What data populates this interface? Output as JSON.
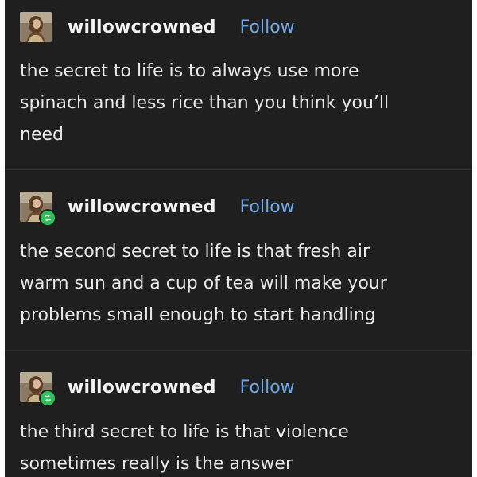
{
  "posts": [
    {
      "username": "willowcrowned",
      "follow_label": "Follow",
      "reblog": false,
      "text": "the secret to life is to always use more\nspinach and less rice than you think you’ll\nneed"
    },
    {
      "username": "willowcrowned",
      "follow_label": "Follow",
      "reblog": true,
      "text": "the second secret to life is that fresh air\nwarm sun and a cup of tea will make your\nproblems small enough to start handling"
    },
    {
      "username": "willowcrowned",
      "follow_label": "Follow",
      "reblog": true,
      "text": "the third secret to life is that violence\nsometimes really is the answer"
    }
  ],
  "colors": {
    "background": "#1f1f1f",
    "text": "#e8e8e8",
    "username": "#f2f2f2",
    "follow": "#6ea8e6",
    "reblog_badge": "#2fbf5a"
  },
  "icons": {
    "avatar": "avatar-portrait",
    "reblog_badge": "reblog-icon"
  }
}
